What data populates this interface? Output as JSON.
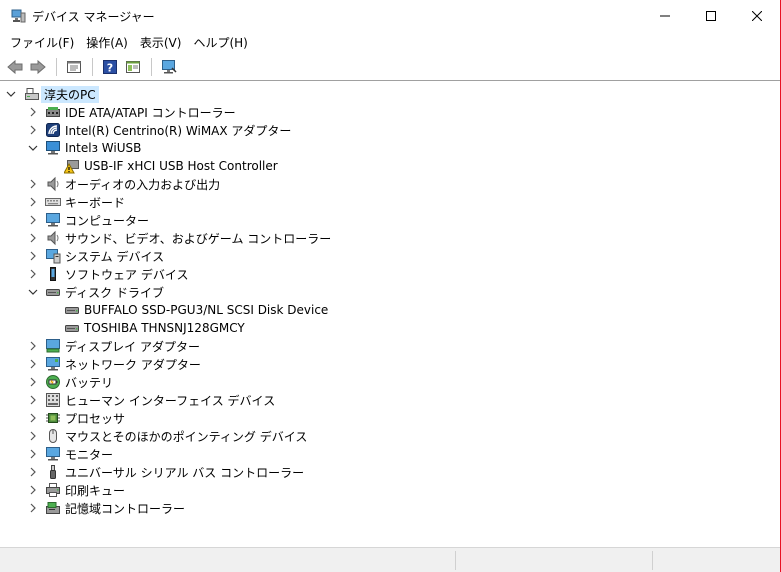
{
  "window": {
    "title": "デバイス マネージャー"
  },
  "menu": [
    "ファイル(F)",
    "操作(A)",
    "表示(V)",
    "ヘルプ(H)"
  ],
  "tree": {
    "root": "淳夫のPC",
    "items": [
      {
        "label": "IDE ATA/ATAPI コントローラー",
        "icon": "ide-controller-icon",
        "expanded": false,
        "level": 1
      },
      {
        "label": "Intel(R) Centrino(R) WiMAX アダプター",
        "icon": "wimax-adapter-icon",
        "expanded": false,
        "level": 1
      },
      {
        "label": "Intelз WiUSB",
        "icon": "monitor-network-icon",
        "expanded": true,
        "level": 1
      },
      {
        "label": "USB-IF xHCI USB Host Controller",
        "icon": "warning-device-icon",
        "level": 2
      },
      {
        "label": "オーディオの入力および出力",
        "icon": "speaker-icon",
        "expanded": false,
        "level": 1
      },
      {
        "label": "キーボード",
        "icon": "keyboard-icon",
        "expanded": false,
        "level": 1
      },
      {
        "label": "コンピューター",
        "icon": "computer-icon",
        "expanded": false,
        "level": 1
      },
      {
        "label": "サウンド、ビデオ、およびゲーム コントローラー",
        "icon": "sound-icon",
        "expanded": false,
        "level": 1
      },
      {
        "label": "システム デバイス",
        "icon": "system-device-icon",
        "expanded": false,
        "level": 1
      },
      {
        "label": "ソフトウェア デバイス",
        "icon": "software-device-icon",
        "expanded": false,
        "level": 1
      },
      {
        "label": "ディスク ドライブ",
        "icon": "disk-drive-icon",
        "expanded": true,
        "level": 1
      },
      {
        "label": "BUFFALO SSD-PGU3/NL SCSI Disk Device",
        "icon": "disk-icon",
        "level": 2
      },
      {
        "label": "TOSHIBA THNSNJ128GMCY",
        "icon": "disk-icon",
        "level": 2
      },
      {
        "label": "ディスプレイ アダプター",
        "icon": "display-adapter-icon",
        "expanded": false,
        "level": 1
      },
      {
        "label": "ネットワーク アダプター",
        "icon": "network-adapter-icon",
        "expanded": false,
        "level": 1
      },
      {
        "label": "バッテリ",
        "icon": "battery-icon",
        "expanded": false,
        "level": 1
      },
      {
        "label": "ヒューマン インターフェイス デバイス",
        "icon": "hid-icon",
        "expanded": false,
        "level": 1
      },
      {
        "label": "プロセッサ",
        "icon": "processor-icon",
        "expanded": false,
        "level": 1
      },
      {
        "label": "マウスとそのほかのポインティング デバイス",
        "icon": "mouse-icon",
        "expanded": false,
        "level": 1
      },
      {
        "label": "モニター",
        "icon": "monitor-icon",
        "expanded": false,
        "level": 1
      },
      {
        "label": "ユニバーサル シリアル バス コントローラー",
        "icon": "usb-icon",
        "expanded": false,
        "level": 1
      },
      {
        "label": "印刷キュー",
        "icon": "printer-icon",
        "expanded": false,
        "level": 1
      },
      {
        "label": "記憶域コントローラー",
        "icon": "storage-controller-icon",
        "expanded": false,
        "level": 1
      }
    ]
  },
  "colors": {
    "selection": "#cce8ff",
    "close_hover": "#e81123"
  }
}
